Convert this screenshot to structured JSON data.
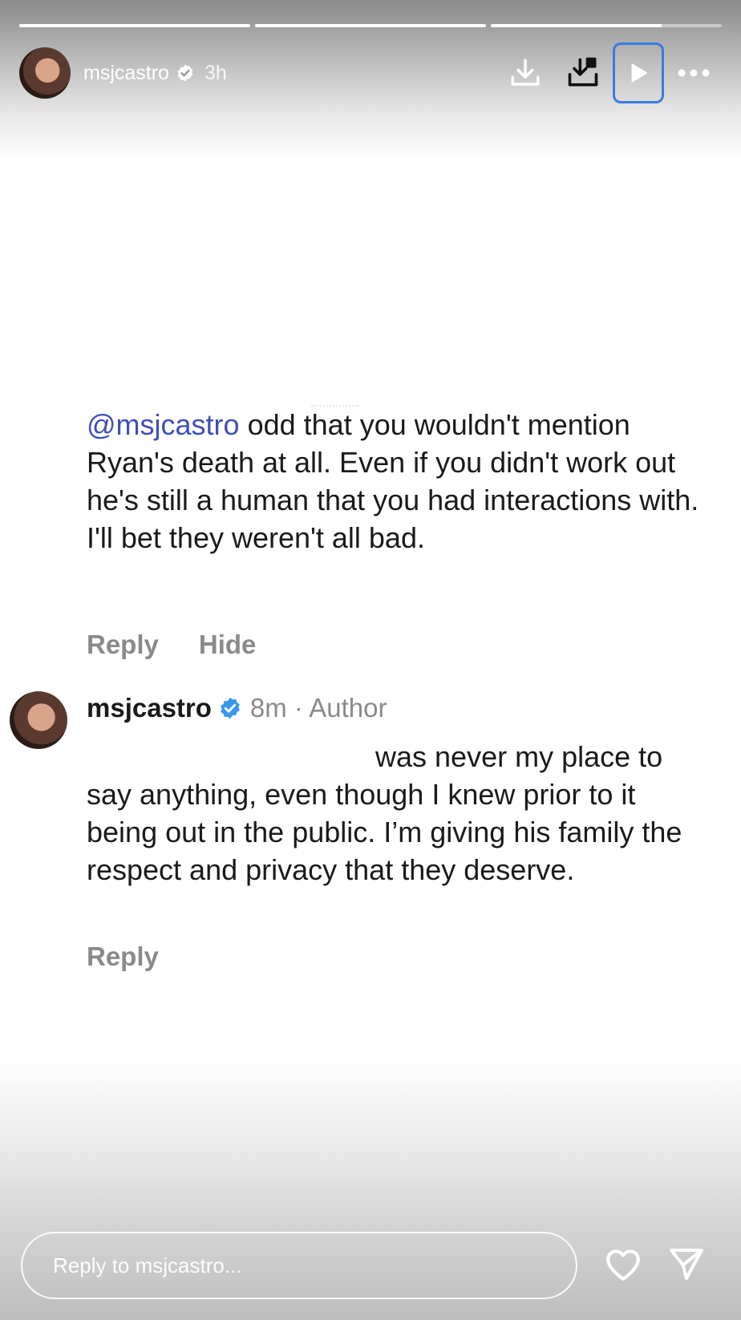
{
  "story": {
    "progress_segments": [
      1,
      1,
      0.74
    ],
    "username": "msjcastro",
    "time": "3h"
  },
  "icons": {
    "download": "download-icon",
    "save": "save-to-device-icon",
    "play": "play-icon",
    "more": "more-horizontal-icon",
    "heart": "heart-icon",
    "send": "send-icon"
  },
  "comment": {
    "mention": "@msjcastro",
    "text": " odd that you wouldn't mention Ryan's death at all. Even if you didn't work out he's still a human that you had interactions with. I'll bet they weren't all bad.",
    "reply_label": "Reply",
    "hide_label": "Hide"
  },
  "reply": {
    "username": "msjcastro",
    "meta": "8m · Author",
    "text_visible": "was never my place to say anything, even though I knew prior to it being out in the public. I’m giving his family the respect and privacy that they deserve.",
    "reply_label": "Reply"
  },
  "reply_input": {
    "placeholder": "Reply to msjcastro..."
  },
  "colors": {
    "mention": "#3e4fb8",
    "verified": "#3897f0",
    "play_highlight": "#3b7bde"
  }
}
